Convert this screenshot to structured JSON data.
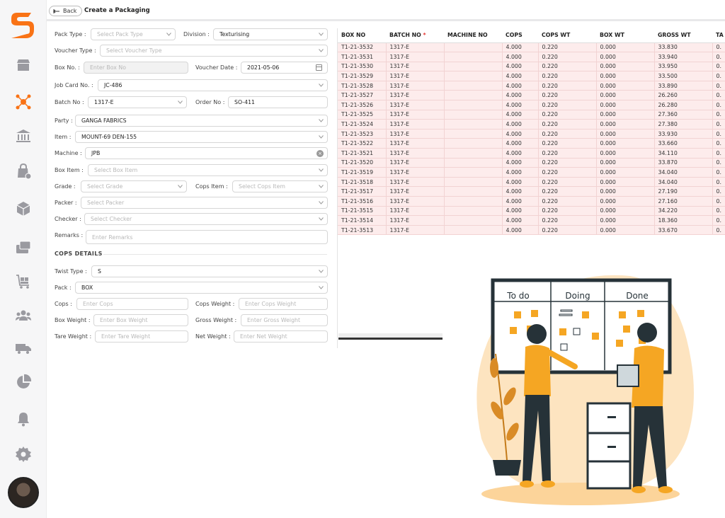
{
  "app": {
    "brand_color": "#f97316"
  },
  "header": {
    "back_label": "Back",
    "title": "Create a Packaging"
  },
  "nav": [
    "store-icon",
    "connections-icon",
    "bank-icon",
    "shopping-bag-icon",
    "package-icon",
    "payment-card-icon",
    "warehouse-cart-icon",
    "users-icon",
    "truck-icon",
    "pie-chart-icon",
    "bell-icon",
    "settings-icon"
  ],
  "form": {
    "pack_type": {
      "label": "Pack Type :",
      "placeholder": "Select Pack Type"
    },
    "division": {
      "label": "Division :",
      "value": "Texturising"
    },
    "voucher_type": {
      "label": "Voucher Type :",
      "placeholder": "Select Voucher Type"
    },
    "box_no": {
      "label": "Box No. :",
      "placeholder": "Enter Box No"
    },
    "voucher_date": {
      "label": "Voucher Date :",
      "value": "2021-05-06"
    },
    "job_card_no": {
      "label": "Job Card No. :",
      "value": "JC-486"
    },
    "batch_no": {
      "label": "Batch No :",
      "value": "1317-E"
    },
    "order_no": {
      "label": "Order No :",
      "value": "SO-411"
    },
    "party": {
      "label": "Party :",
      "value": "GANGA FABRICS"
    },
    "item": {
      "label": "Item :",
      "value": "MOUNT-69 DEN-155"
    },
    "machine": {
      "label": "Machine :",
      "value": "JPB"
    },
    "box_item": {
      "label": "Box Item :",
      "placeholder": "Select Box Item"
    },
    "grade": {
      "label": "Grade :",
      "placeholder": "Select Grade"
    },
    "cops_item": {
      "label": "Cops Item :",
      "placeholder": "Select Cops Item"
    },
    "packer": {
      "label": "Packer :",
      "placeholder": "Select Packer"
    },
    "checker": {
      "label": "Checker :",
      "placeholder": "Select Checker"
    },
    "remarks": {
      "label": "Remarks :",
      "placeholder": "Enter Remarks"
    },
    "cops_details_heading": "COPS DETAILS",
    "twist_type": {
      "label": "Twist Type :",
      "value": "S"
    },
    "pack": {
      "label": "Pack :",
      "value": "BOX"
    },
    "cops": {
      "label": "Cops :",
      "placeholder": "Enter Cops"
    },
    "cops_weight": {
      "label": "Cops Weight :",
      "placeholder": "Enter Cops Weight"
    },
    "box_weight": {
      "label": "Box Weight :",
      "placeholder": "Enter Box Weight"
    },
    "gross_weight": {
      "label": "Gross Weight :",
      "placeholder": "Enter Gross Weight"
    },
    "tare_weight": {
      "label": "Tare Weight :",
      "placeholder": "Enter Tare Weight"
    },
    "net_weight": {
      "label": "Net Weight :",
      "placeholder": "Enter Net Weight"
    }
  },
  "table": {
    "columns": [
      "BOX NO",
      "BATCH NO",
      "MACHINE NO",
      "COPS",
      "COPS WT",
      "BOX WT",
      "GROSS WT",
      "TA"
    ],
    "required_mark": "*",
    "rows": [
      [
        "T1-21-3532",
        "1317-E",
        "",
        "4.000",
        "0.220",
        "0.000",
        "33.830",
        "0."
      ],
      [
        "T1-21-3531",
        "1317-E",
        "",
        "4.000",
        "0.220",
        "0.000",
        "33.940",
        "0."
      ],
      [
        "T1-21-3530",
        "1317-E",
        "",
        "4.000",
        "0.220",
        "0.000",
        "33.950",
        "0."
      ],
      [
        "T1-21-3529",
        "1317-E",
        "",
        "4.000",
        "0.220",
        "0.000",
        "33.500",
        "0."
      ],
      [
        "T1-21-3528",
        "1317-E",
        "",
        "4.000",
        "0.220",
        "0.000",
        "33.890",
        "0."
      ],
      [
        "T1-21-3527",
        "1317-E",
        "",
        "4.000",
        "0.220",
        "0.000",
        "26.260",
        "0."
      ],
      [
        "T1-21-3526",
        "1317-E",
        "",
        "4.000",
        "0.220",
        "0.000",
        "26.280",
        "0."
      ],
      [
        "T1-21-3525",
        "1317-E",
        "",
        "4.000",
        "0.220",
        "0.000",
        "27.360",
        "0."
      ],
      [
        "T1-21-3524",
        "1317-E",
        "",
        "4.000",
        "0.220",
        "0.000",
        "27.380",
        "0."
      ],
      [
        "T1-21-3523",
        "1317-E",
        "",
        "4.000",
        "0.220",
        "0.000",
        "33.930",
        "0."
      ],
      [
        "T1-21-3522",
        "1317-E",
        "",
        "4.000",
        "0.220",
        "0.000",
        "33.660",
        "0."
      ],
      [
        "T1-21-3521",
        "1317-E",
        "",
        "4.000",
        "0.220",
        "0.000",
        "34.110",
        "0."
      ],
      [
        "T1-21-3520",
        "1317-E",
        "",
        "4.000",
        "0.220",
        "0.000",
        "33.870",
        "0."
      ],
      [
        "T1-21-3519",
        "1317-E",
        "",
        "4.000",
        "0.220",
        "0.000",
        "34.040",
        "0."
      ],
      [
        "T1-21-3518",
        "1317-E",
        "",
        "4.000",
        "0.220",
        "0.000",
        "34.040",
        "0."
      ],
      [
        "T1-21-3517",
        "1317-E",
        "",
        "4.000",
        "0.220",
        "0.000",
        "27.190",
        "0."
      ],
      [
        "T1-21-3516",
        "1317-E",
        "",
        "4.000",
        "0.220",
        "0.000",
        "27.160",
        "0."
      ],
      [
        "T1-21-3515",
        "1317-E",
        "",
        "4.000",
        "0.220",
        "0.000",
        "34.220",
        "0."
      ],
      [
        "T1-21-3514",
        "1317-E",
        "",
        "4.000",
        "0.220",
        "0.000",
        "18.360",
        "0."
      ],
      [
        "T1-21-3513",
        "1317-E",
        "",
        "4.000",
        "0.220",
        "0.000",
        "33.670",
        "0."
      ]
    ]
  },
  "illustration": {
    "board_columns": [
      "To do",
      "Doing",
      "Done"
    ],
    "accent_color": "#f5a623",
    "blob_color": "#fde4c0"
  }
}
